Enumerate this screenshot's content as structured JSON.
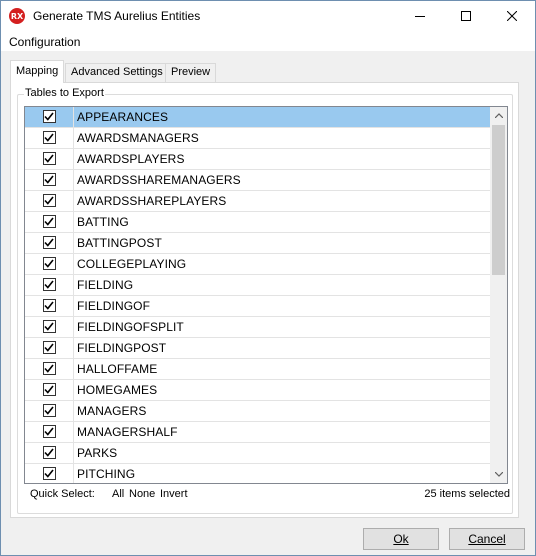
{
  "window": {
    "title": "Generate TMS Aurelius Entities",
    "icon_label": "RX"
  },
  "menu": {
    "items": [
      {
        "label": "Configuration"
      }
    ]
  },
  "tabs": [
    {
      "label": "Mapping",
      "active": true
    },
    {
      "label": "Advanced Settings",
      "active": false
    },
    {
      "label": "Preview",
      "active": false
    }
  ],
  "tables_group": {
    "label": "Tables to Export",
    "items": [
      {
        "label": "APPEARANCES",
        "checked": true,
        "selected": true
      },
      {
        "label": "AWARDSMANAGERS",
        "checked": true
      },
      {
        "label": "AWARDSPLAYERS",
        "checked": true
      },
      {
        "label": "AWARDSSHAREMANAGERS",
        "checked": true
      },
      {
        "label": "AWARDSSHAREPLAYERS",
        "checked": true
      },
      {
        "label": "BATTING",
        "checked": true
      },
      {
        "label": "BATTINGPOST",
        "checked": true
      },
      {
        "label": "COLLEGEPLAYING",
        "checked": true
      },
      {
        "label": "FIELDING",
        "checked": true
      },
      {
        "label": "FIELDINGOF",
        "checked": true
      },
      {
        "label": "FIELDINGOFSPLIT",
        "checked": true
      },
      {
        "label": "FIELDINGPOST",
        "checked": true
      },
      {
        "label": "HALLOFFAME",
        "checked": true
      },
      {
        "label": "HOMEGAMES",
        "checked": true
      },
      {
        "label": "MANAGERS",
        "checked": true
      },
      {
        "label": "MANAGERSHALF",
        "checked": true
      },
      {
        "label": "PARKS",
        "checked": true
      },
      {
        "label": "PITCHING",
        "checked": true
      }
    ]
  },
  "quick_select": {
    "label": "Quick Select:",
    "all": "All",
    "none": "None",
    "invert": "Invert"
  },
  "status": {
    "selected_count": "25 items selected"
  },
  "buttons": {
    "ok": "Ok",
    "cancel": "Cancel"
  }
}
